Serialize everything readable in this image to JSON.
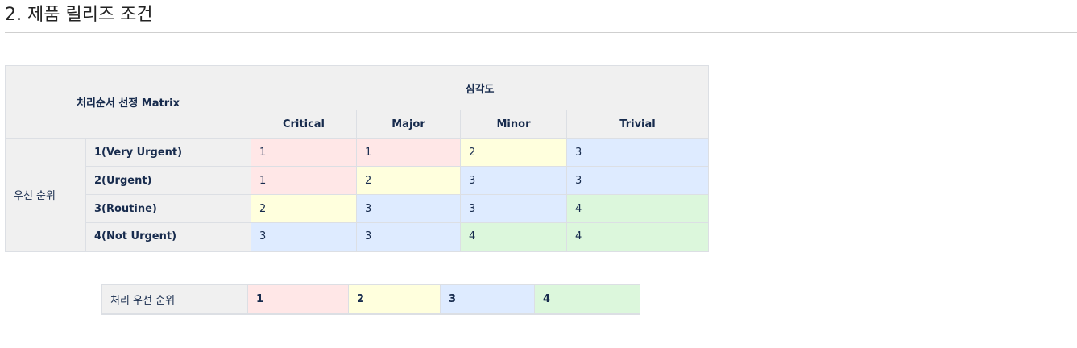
{
  "page": {
    "title": "2. 제품 릴리즈 조건"
  },
  "matrix": {
    "corner_label": "처리순서 선정 Matrix",
    "severity_label": "심각도",
    "severity_columns": [
      "Critical",
      "Major",
      "Minor",
      "Trivial"
    ],
    "priority_group_label": "우선 순위",
    "rows": [
      {
        "label": "1(Very Urgent)",
        "values": [
          "1",
          "1",
          "2",
          "3"
        ]
      },
      {
        "label": "2(Urgent)",
        "values": [
          "1",
          "2",
          "3",
          "3"
        ]
      },
      {
        "label": "3(Routine)",
        "values": [
          "2",
          "3",
          "3",
          "4"
        ]
      },
      {
        "label": "4(Not Urgent)",
        "values": [
          "3",
          "3",
          "4",
          "4"
        ]
      }
    ]
  },
  "legend": {
    "label": "처리 우선 순위",
    "values": [
      "1",
      "2",
      "3",
      "4"
    ]
  },
  "colors": {
    "1": "#ffe7e7",
    "2": "#ffffdd",
    "3": "#deebff",
    "4": "#dcf7dc"
  }
}
